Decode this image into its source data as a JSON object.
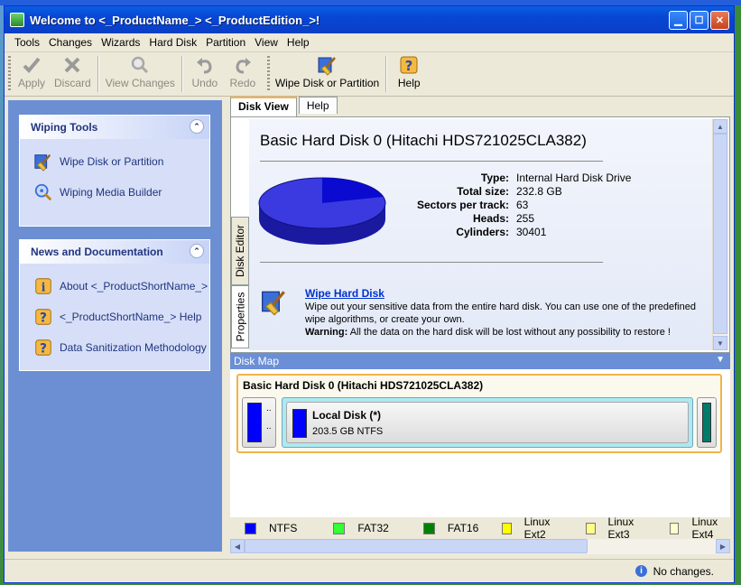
{
  "window": {
    "title": "Welcome to <_ProductName_> <_ProductEdition_>!"
  },
  "menu": [
    "Tools",
    "Changes",
    "Wizards",
    "Hard Disk",
    "Partition",
    "View",
    "Help"
  ],
  "toolbar": {
    "apply": "Apply",
    "discard": "Discard",
    "view_changes": "View Changes",
    "undo": "Undo",
    "redo": "Redo",
    "wipe": "Wipe Disk or Partition",
    "help": "Help"
  },
  "sidebar": {
    "wiping_tools": {
      "title": "Wiping Tools",
      "items": [
        "Wipe Disk or Partition",
        "Wiping Media Builder"
      ]
    },
    "news": {
      "title": "News and Documentation",
      "items": [
        "About <_ProductShortName_>",
        "<_ProductShortName_> Help",
        "Data Sanitization Methodology"
      ]
    }
  },
  "tabs": [
    "Disk View",
    "Help"
  ],
  "vtabs": [
    "Disk Editor",
    "Properties"
  ],
  "disk": {
    "title": "Basic Hard Disk 0 (Hitachi HDS721025CLA382)",
    "info": [
      {
        "k": "Type:",
        "v": "Internal Hard Disk Drive"
      },
      {
        "k": "Total size:",
        "v": "232.8 GB"
      },
      {
        "k": "Sectors per track:",
        "v": "63"
      },
      {
        "k": "Heads:",
        "v": "255"
      },
      {
        "k": "Cylinders:",
        "v": "30401"
      }
    ],
    "wipe_link": "Wipe Hard Disk",
    "wipe_desc": "Wipe out your sensitive data from the entire hard disk. You can use one of the predefined wipe algorithms, or create your own.",
    "warning_label": "Warning:",
    "warning_text": "All the data on the hard disk will be lost without any possibility to restore !"
  },
  "diskmap": {
    "bar_title": "Disk Map",
    "disk_title": "Basic Hard Disk 0 (Hitachi HDS721025CLA382)",
    "small_part_label": "..",
    "partition": {
      "name": "Local Disk (*)",
      "size": "203.5 GB NTFS"
    }
  },
  "legend": [
    {
      "name": "NTFS",
      "color": "#0000ff"
    },
    {
      "name": "FAT32",
      "color": "#33ff33"
    },
    {
      "name": "FAT16",
      "color": "#008000"
    },
    {
      "name": "Linux Ext2",
      "color": "#ffff00"
    },
    {
      "name": "Linux Ext3",
      "color": "#ffff88"
    },
    {
      "name": "Linux Ext4",
      "color": "#ffffcc"
    }
  ],
  "status": {
    "text": "No changes."
  }
}
